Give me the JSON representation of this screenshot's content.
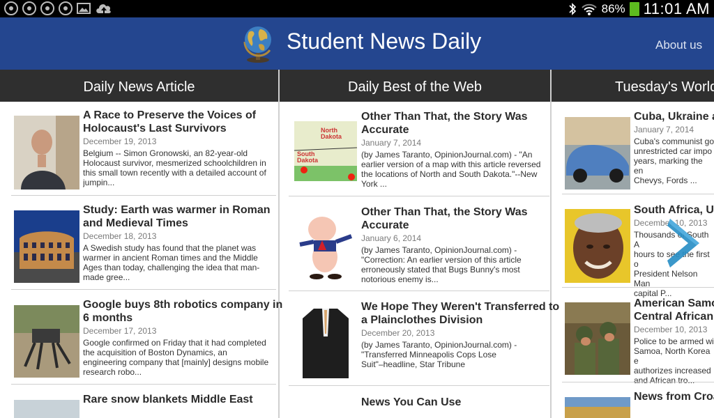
{
  "status_bar": {
    "battery_percent": "86%",
    "time": "11:01 AM",
    "left_icons": [
      "notification-icon",
      "notification-icon",
      "notification-icon",
      "notification-icon",
      "gallery-icon",
      "cloud-upload-icon"
    ],
    "right_icons": [
      "bluetooth-icon",
      "wifi-icon",
      "battery-icon"
    ],
    "battery_color": "#5dbb1f"
  },
  "header": {
    "app_title": "Student News Daily",
    "about_label": "About us",
    "background_color": "#24468f",
    "logo_icon": "globe-icon"
  },
  "columns": [
    {
      "heading": "Daily News Article",
      "items": [
        {
          "title_lines": [
            "A Race to Preserve the Voices of",
            "Holocaust's Last Survivors"
          ],
          "date": "December 19, 2013",
          "summary_lines": [
            "Belgium -- Simon Gronowski, an 82-year-old",
            "Holocaust survivor, mesmerized schoolchildren in",
            "this small town recently with a detailed account of",
            "jumpin..."
          ]
        },
        {
          "title_lines": [
            "Study: Earth was warmer in Roman",
            "and Medieval Times"
          ],
          "date": "December 18, 2013",
          "summary_lines": [
            "A Swedish study has found that the planet was",
            "warmer in ancient Roman times and the Middle",
            "Ages than today, challenging the idea that man-",
            "made gree..."
          ]
        },
        {
          "title_lines": [
            "Google buys 8th robotics company in",
            "6 months"
          ],
          "date": "December 17, 2013",
          "summary_lines": [
            "Google confirmed on Friday that it had completed",
            "the acquisition of Boston Dynamics, an",
            "engineering company that [mainly] designs mobile",
            "research robo..."
          ]
        },
        {
          "title_lines": [
            "Rare snow blankets Middle East"
          ],
          "date": "",
          "summary_lines": []
        }
      ]
    },
    {
      "heading": "Daily Best of the Web",
      "items": [
        {
          "title_lines": [
            "Other Than That, the Story Was",
            "Accurate"
          ],
          "date": "January 7, 2014",
          "summary_lines": [
            "(by James Taranto, OpinionJournal.com) - \"An",
            "earlier version of a map with this article reversed",
            "the locations of North and South Dakota.\"--New",
            "York ..."
          ]
        },
        {
          "title_lines": [
            "Other Than That, the Story Was",
            "Accurate"
          ],
          "date": "January 6, 2014",
          "summary_lines": [
            "(by James Taranto, OpinionJournal.com) -",
            "\"Correction: An earlier version of this article",
            "erroneously stated that Bugs Bunny's most",
            "notorious enemy is..."
          ]
        },
        {
          "title_lines": [
            "We Hope They Weren't Transferred to",
            "a Plainclothes Division"
          ],
          "date": "December 20, 2013",
          "summary_lines": [
            "(by James Taranto, OpinionJournal.com) -",
            "\"Transferred Minneapolis Cops Lose",
            "Suit\"–headline, Star Tribune"
          ]
        },
        {
          "title_lines": [
            "News You Can Use"
          ],
          "date": "",
          "summary_lines": []
        }
      ]
    },
    {
      "heading": "Tuesday's World",
      "items": [
        {
          "title_lines": [
            "Cuba, Ukraine a"
          ],
          "date": "January 7, 2014",
          "summary_lines": [
            "Cuba's communist go",
            "unrestricted car impo",
            "years, marking the en",
            "Chevys, Fords ..."
          ]
        },
        {
          "title_lines": [
            "South Africa, Ur"
          ],
          "date": "December 10, 2013",
          "summary_lines": [
            "Thousands of South A",
            "hours to see the first o",
            "President Nelson Man",
            "capital P..."
          ]
        },
        {
          "title_lines": [
            "American Samo",
            "Central African I"
          ],
          "date": "December 10, 2013",
          "summary_lines": [
            "Police to be armed wi",
            "Samoa, North Korea e",
            "authorizes increased",
            "and African tro..."
          ]
        },
        {
          "title_lines": [
            "News from Croa"
          ],
          "date": "",
          "summary_lines": []
        }
      ]
    }
  ],
  "next_button_icon": "chevron-right-icon",
  "accent_color": "#2a8fc6"
}
